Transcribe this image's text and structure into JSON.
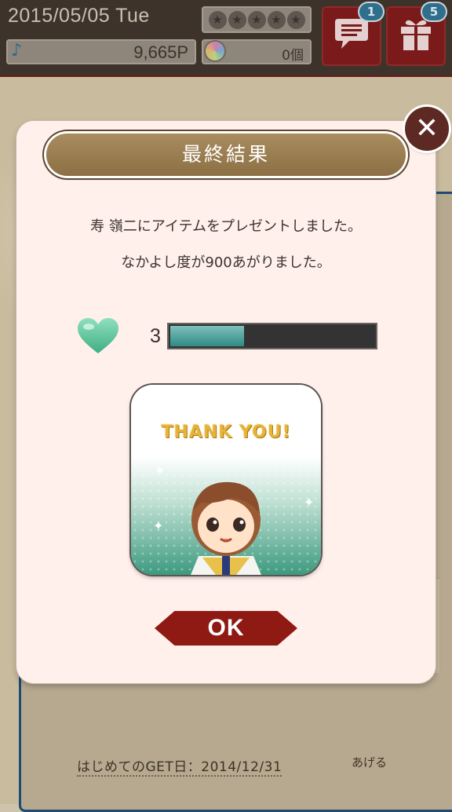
{
  "status": {
    "date": "2015/05/05 Tue",
    "points": "9,665P",
    "gems": "0個",
    "chat_badge": "1",
    "gift_badge": "5",
    "icons": {
      "note": "music-note-icon",
      "gem": "rainbow-gem-icon",
      "chat": "chat-bubble-icon",
      "gift": "gift-box-icon"
    }
  },
  "background": {
    "first_get_date": "はじめてのGET日：2014/12/31",
    "link_text": "あげる"
  },
  "dialog": {
    "title": "最終結果",
    "message_1": "寿 嶺二にアイテムをプレゼントしました。",
    "message_2": "なかよし度が900あがりました。",
    "affection_level": "3",
    "affection_progress": 0.37,
    "thank_you": "THANK YOU!",
    "ok_label": "OK",
    "close_glyph": "✕"
  },
  "colors": {
    "accent": "#8f1a14",
    "title_bar": "#9a7d51",
    "heart": "#5cc79b",
    "progress": "#2f8a84"
  }
}
